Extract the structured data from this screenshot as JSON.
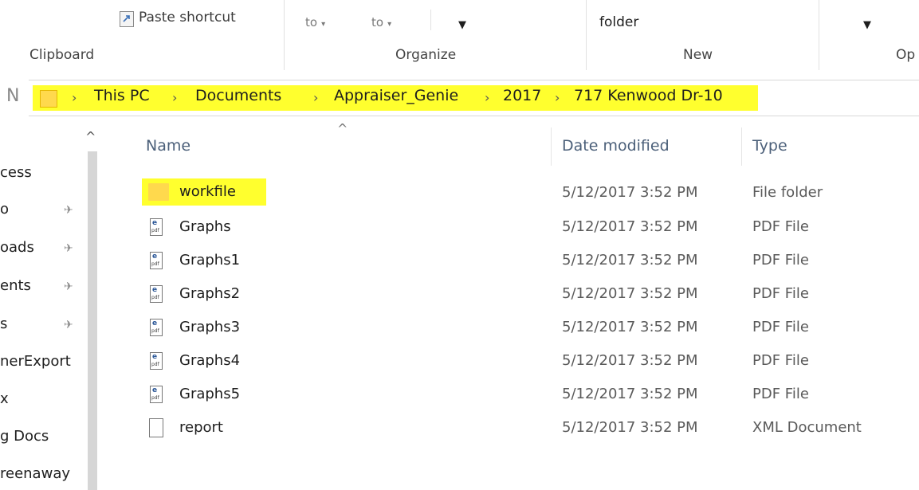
{
  "ribbon": {
    "paste_shortcut": "Paste shortcut",
    "move_to": "to",
    "copy_to": "to",
    "new_folder_partial": "folder",
    "groups": {
      "clipboard": "Clipboard",
      "organize": "Organize",
      "new": "New",
      "open_partial": "Op"
    }
  },
  "address": {
    "crumbs": [
      "This PC",
      "Documents",
      "Appraiser_Genie",
      "2017",
      "717 Kenwood Dr-10"
    ],
    "highlight_color": "#ffff2e"
  },
  "nav": {
    "items": [
      "cess",
      "o",
      "oads",
      "ents",
      "s",
      "nerExport",
      "x",
      "g Docs",
      "reenaway"
    ]
  },
  "columns": {
    "name": "Name",
    "date": "Date modified",
    "type": "Type"
  },
  "files": [
    {
      "name": "workfile",
      "date": "5/12/2017 3:52 PM",
      "type": "File folder",
      "icon": "folder-icon"
    },
    {
      "name": "Graphs",
      "date": "5/12/2017 3:52 PM",
      "type": "PDF File",
      "icon": "pdf-icon"
    },
    {
      "name": "Graphs1",
      "date": "5/12/2017 3:52 PM",
      "type": "PDF File",
      "icon": "pdf-icon"
    },
    {
      "name": "Graphs2",
      "date": "5/12/2017 3:52 PM",
      "type": "PDF File",
      "icon": "pdf-icon"
    },
    {
      "name": "Graphs3",
      "date": "5/12/2017 3:52 PM",
      "type": "PDF File",
      "icon": "pdf-icon"
    },
    {
      "name": "Graphs4",
      "date": "5/12/2017 3:52 PM",
      "type": "PDF File",
      "icon": "pdf-icon"
    },
    {
      "name": "Graphs5",
      "date": "5/12/2017 3:52 PM",
      "type": "PDF File",
      "icon": "pdf-icon"
    },
    {
      "name": "report",
      "date": "5/12/2017 3:52 PM",
      "type": "XML Document",
      "icon": "document-icon"
    }
  ]
}
